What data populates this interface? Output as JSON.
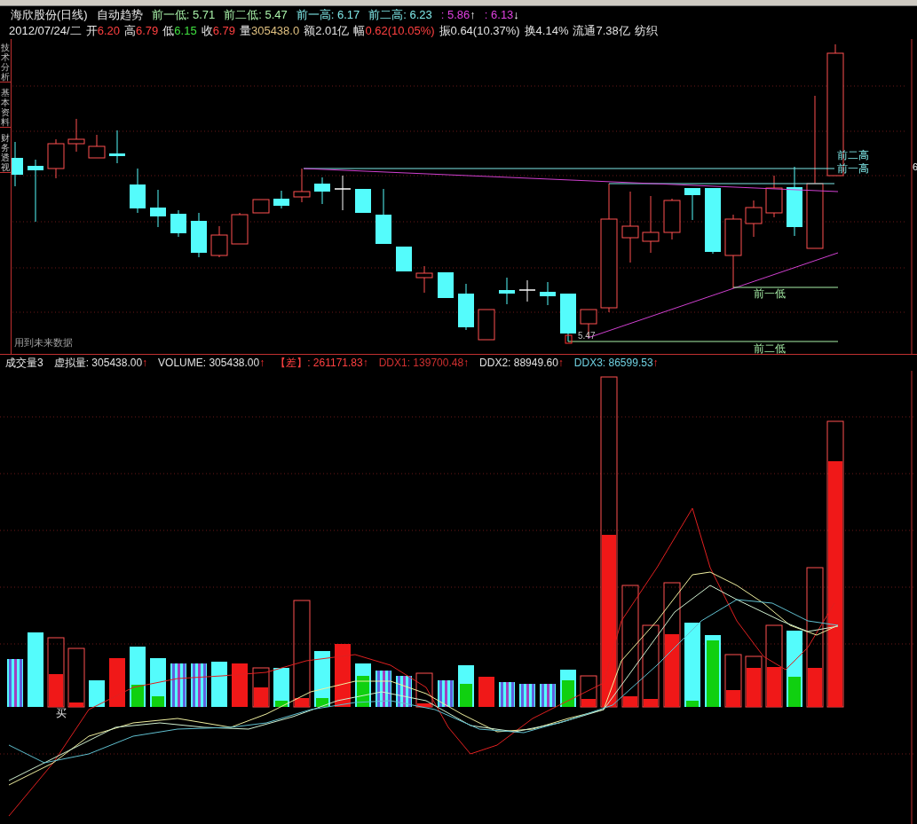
{
  "side_tabs": [
    {
      "label": "技术分析",
      "selected": false
    },
    {
      "label": "基本资料",
      "selected": false
    },
    {
      "label": "财务透视",
      "selected": false
    }
  ],
  "header": {
    "title": "海欣股份(日线)",
    "indicator": "自动趋势",
    "levels": [
      {
        "text": "前一低: 5.71",
        "color": "#a8f0a8"
      },
      {
        "text": "前二低: 5.47",
        "color": "#a8f0a8"
      },
      {
        "text": "前一高: 6.17",
        "color": "#7fe8e8"
      },
      {
        "text": "前二高: 6.23",
        "color": "#7fe8e8"
      },
      {
        "text": ": 5.86",
        "arrow": "↑",
        "color": "#e040e0"
      },
      {
        "text": ": 6.13",
        "arrow": "↓",
        "color": "#e040e0"
      }
    ]
  },
  "quote": {
    "date": "2012/07/24/二",
    "fields": [
      {
        "label": "开",
        "value": "6.20",
        "color": "#ff4040"
      },
      {
        "label": "高",
        "value": "6.79",
        "color": "#ff4040"
      },
      {
        "label": "低",
        "value": "6.15",
        "color": "#40e040"
      },
      {
        "label": "收",
        "value": "6.79",
        "color": "#ff4040"
      },
      {
        "label": "量",
        "value": "305438.0",
        "color": "#e0c080"
      },
      {
        "label": "额",
        "value": "2.01亿",
        "color": "#e0e0e0"
      },
      {
        "label": "幅",
        "value": "0.62(10.05%)",
        "color": "#ff4040"
      },
      {
        "label": "振",
        "value": "0.64(10.37%)",
        "color": "#e0e0e0"
      },
      {
        "label": "换",
        "value": "4.14%",
        "color": "#e0e0e0"
      },
      {
        "label": "流通",
        "value": "7.38亿",
        "color": "#e0e0e0"
      },
      {
        "value": "纺织",
        "color": "#e0e0e0"
      }
    ]
  },
  "chart_labels": {
    "high2": "前二高",
    "high1": "前一高",
    "low1": "前一低",
    "low2": "前二低",
    "low_price": "5.47",
    "price_tag": "6",
    "warning": "用到未来数据"
  },
  "volume_panel": {
    "title": "成交量3",
    "readings": [
      {
        "text": "虚拟量: 305438.00",
        "color": "#e0e0e0"
      },
      {
        "text": "VOLUME: 305438.00",
        "color": "#e0e0e0"
      },
      {
        "text": "【差】: 261171.83",
        "color": "#ff4040"
      },
      {
        "text": "DDX1: 139700.48",
        "color": "#d03030"
      },
      {
        "text": "DDX2: 88949.60",
        "color": "#e0e0e0"
      },
      {
        "text": "DDX3: 86599.53",
        "color": "#6fd0e0"
      }
    ],
    "arrow": "↑",
    "buy_signal": "买"
  }
}
